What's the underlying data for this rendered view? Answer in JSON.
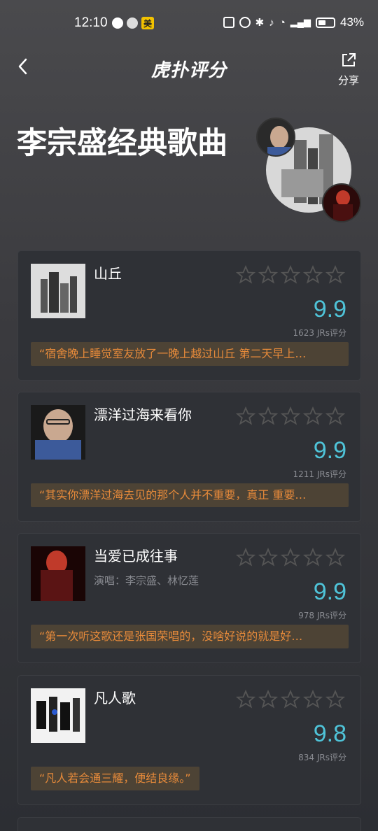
{
  "status_bar": {
    "time": "12:10",
    "badge": "美",
    "battery": "43%"
  },
  "nav": {
    "title": "虎扑评分",
    "share_label": "分享"
  },
  "header": {
    "title": "李宗盛经典歌曲"
  },
  "songs": [
    {
      "title": "山丘",
      "artist": "",
      "score": "9.9",
      "rating_count": "1623 JRs评分",
      "comment": "“宿舍晚上睡觉室友放了一晚上越过山丘 第二天早上…"
    },
    {
      "title": "漂洋过海来看你",
      "artist": "",
      "score": "9.9",
      "rating_count": "1211 JRs评分",
      "comment": "“其实你漂洋过海去见的那个人并不重要，真正 重要…"
    },
    {
      "title": "当爱已成往事",
      "artist": "演唱：李宗盛、林忆莲",
      "score": "9.9",
      "rating_count": "978 JRs评分",
      "comment": "“第一次听这歌还是张国荣唱的，没啥好说的就是好…"
    },
    {
      "title": "凡人歌",
      "artist": "",
      "score": "9.8",
      "rating_count": "834 JRs评分",
      "comment": "“凡人若会通三耀，便结良缘。”"
    }
  ],
  "colors": {
    "score": "#4fc3d8",
    "comment_text": "#e68a3a",
    "comment_bg": "#4d4335",
    "card_bg": "#2f3136"
  }
}
